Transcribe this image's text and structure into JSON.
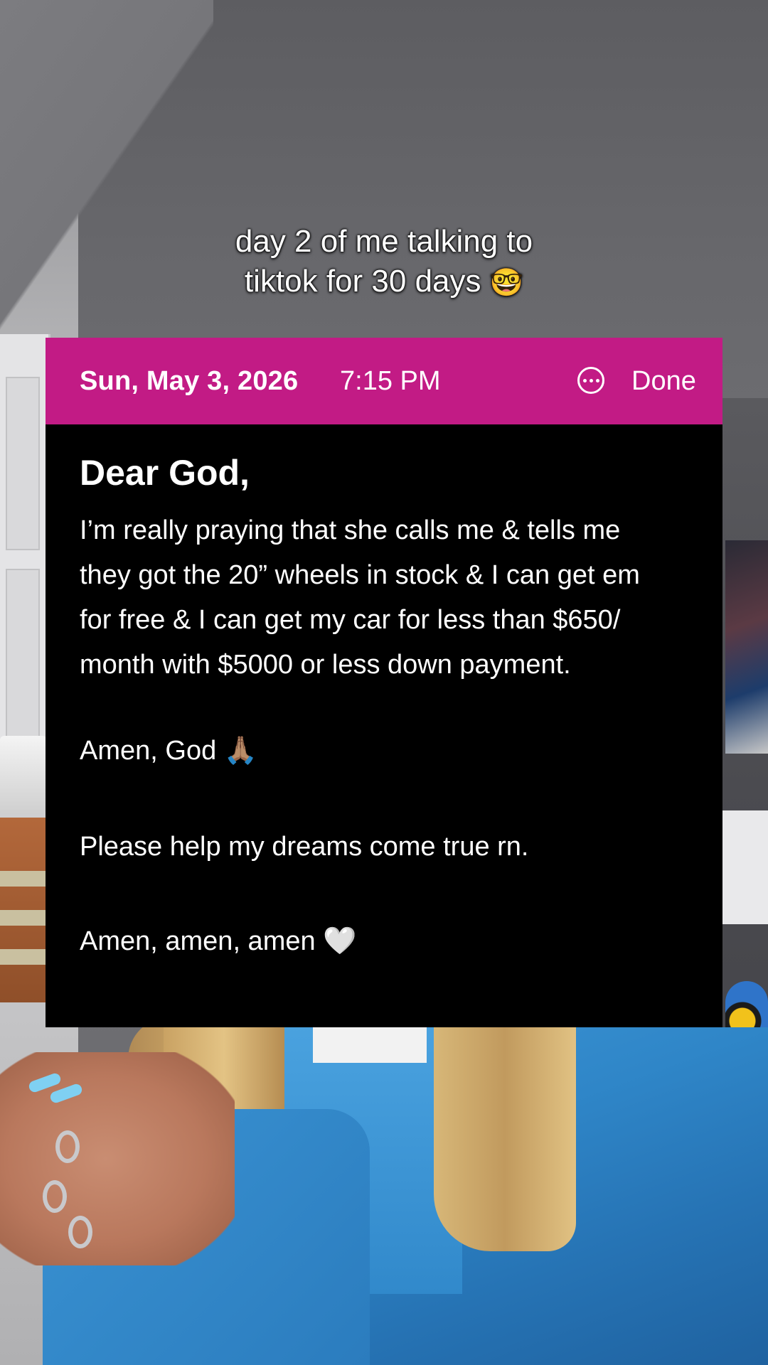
{
  "caption": {
    "line1": "day 2 of me talking to",
    "line2": "tiktok for 30 days",
    "emoji": "🤓"
  },
  "note": {
    "header": {
      "date": "Sun, May 3, 2026",
      "time": "7:15 PM",
      "more_icon": "ellipsis-circle-icon",
      "done_label": "Done",
      "color": "#c21b85"
    },
    "title": "Dear God,",
    "paragraphs": [
      "I’m really praying that she calls me & tells me\nthey got the 20” wheels in stock & I can get em\nfor free & I can get my car for less than $650/\nmonth with $5000 or less down payment.",
      "Amen, God 🙏🏽",
      "Please help my dreams come true rn.",
      "Amen, amen, amen 🤍"
    ]
  }
}
